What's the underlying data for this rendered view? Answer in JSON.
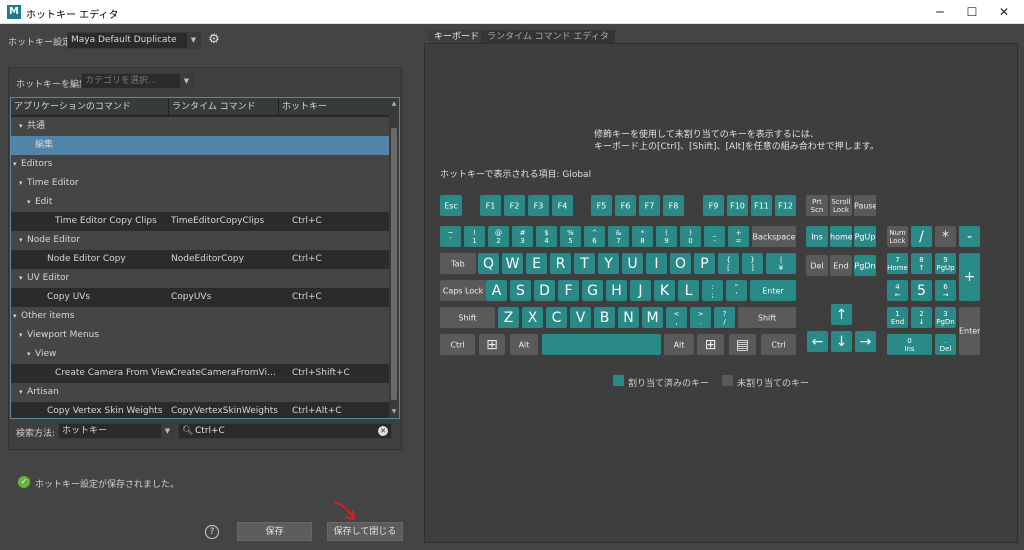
{
  "window": {
    "title": "ホットキー エディタ",
    "icon": "maya-icon",
    "min": "─",
    "max": "☐",
    "close": "✕"
  },
  "left": {
    "setting_label": "ホットキー設定:",
    "setting_value": "Maya Default Duplicate",
    "edit_label": "ホットキーを編集:",
    "edit_placeholder": "カテゴリを選択...",
    "columns": [
      "アプリケーションのコマンド",
      "ランタイム コマンド",
      "ホットキー"
    ],
    "rows": [
      {
        "kind": "grp",
        "indent": 1,
        "arrow": "▾",
        "name": "共通",
        "cmd": "",
        "key": ""
      },
      {
        "kind": "sel",
        "indent": 2,
        "arrow": "",
        "name": "編集",
        "cmd": "",
        "key": ""
      },
      {
        "kind": "grp",
        "indent": 0,
        "arrow": "▾",
        "name": "Editors",
        "cmd": "",
        "key": ""
      },
      {
        "kind": "grp",
        "indent": 1,
        "arrow": "▾",
        "name": "Time Editor",
        "cmd": "",
        "key": ""
      },
      {
        "kind": "grp",
        "indent": 2,
        "arrow": "▾",
        "name": "Edit",
        "cmd": "",
        "key": ""
      },
      {
        "kind": "leaf",
        "indent": 3,
        "arrow": "",
        "name": "Time Editor Copy Clips",
        "cmd": "TimeEditorCopyClips",
        "key": "Ctrl+C"
      },
      {
        "kind": "grp",
        "indent": 1,
        "arrow": "▾",
        "name": "Node Editor",
        "cmd": "",
        "key": ""
      },
      {
        "kind": "leaf",
        "indent": 2,
        "arrow": "",
        "name": "Node Editor Copy",
        "cmd": "NodeEditorCopy",
        "key": "Ctrl+C"
      },
      {
        "kind": "grp",
        "indent": 1,
        "arrow": "▾",
        "name": "UV Editor",
        "cmd": "",
        "key": ""
      },
      {
        "kind": "leaf",
        "indent": 2,
        "arrow": "",
        "name": "Copy UVs",
        "cmd": "CopyUVs",
        "key": "Ctrl+C"
      },
      {
        "kind": "grp",
        "indent": 0,
        "arrow": "▾",
        "name": "Other items",
        "cmd": "",
        "key": ""
      },
      {
        "kind": "grp",
        "indent": 1,
        "arrow": "▾",
        "name": "Viewport Menus",
        "cmd": "",
        "key": ""
      },
      {
        "kind": "grp",
        "indent": 2,
        "arrow": "▾",
        "name": "View",
        "cmd": "",
        "key": ""
      },
      {
        "kind": "leaf",
        "indent": 3,
        "arrow": "",
        "name": "Create Camera From View",
        "cmd": "CreateCameraFromVi…",
        "key": "Ctrl+Shift+C"
      },
      {
        "kind": "grp",
        "indent": 1,
        "arrow": "▾",
        "name": "Artisan",
        "cmd": "",
        "key": ""
      },
      {
        "kind": "leaf",
        "indent": 2,
        "arrow": "",
        "name": "Copy Vertex Skin Weights",
        "cmd": "CopyVertexSkinWeights",
        "key": "Ctrl+Alt+C"
      }
    ],
    "search_label": "検索方法:",
    "search_mode": "ホットキー",
    "search_value": "Ctrl+C",
    "status": "ホットキー設定が保存されました。",
    "help": "?",
    "save": "保存",
    "save_close": "保存して閉じる"
  },
  "right": {
    "tabs": [
      "キーボード",
      "ランタイム コマンド エディタ"
    ],
    "hint1": "修飾キーを使用して未割り当てのキーを表示するには、",
    "hint2": "キーボード上の[Ctrl]、[Shift]、[Alt]を任意の組み合わせで押します。",
    "shown_items": "ホットキーで表示される項目: Global",
    "legend_assigned": "割り当て済みのキー",
    "legend_unassigned": "未割り当てのキー",
    "color_assigned": "#2a8a87",
    "color_unassigned": "#5a5a5a"
  },
  "keyboard": [
    {
      "t": "Esc",
      "on": 1
    },
    {
      "t": "F1",
      "on": 1
    },
    {
      "t": "F2",
      "on": 1
    },
    {
      "t": "F3",
      "on": 1
    },
    {
      "t": "F4",
      "on": 1
    },
    {
      "t": "F5",
      "on": 1
    },
    {
      "t": "F6",
      "on": 1
    },
    {
      "t": "F7",
      "on": 1
    },
    {
      "t": "F8",
      "on": 1
    },
    {
      "t": "F9",
      "on": 1
    },
    {
      "t": "F10",
      "on": 1
    },
    {
      "t": "F11",
      "on": 1
    },
    {
      "t": "F12",
      "on": 1
    },
    {
      "t": "Prt\nScn",
      "on": 0
    },
    {
      "t": "Scroll\nLock",
      "on": 0
    },
    {
      "t": "Pause",
      "on": 0
    },
    {
      "t": "~\n`",
      "on": 1
    },
    {
      "t": "!\n1",
      "on": 1
    },
    {
      "t": "@\n2",
      "on": 1
    },
    {
      "t": "#\n3",
      "on": 1
    },
    {
      "t": "$\n4",
      "on": 1
    },
    {
      "t": "%\n5",
      "on": 1
    },
    {
      "t": "^\n6",
      "on": 1
    },
    {
      "t": "&\n7",
      "on": 1
    },
    {
      "t": "*\n8",
      "on": 1
    },
    {
      "t": "(\n9",
      "on": 1
    },
    {
      "t": ")\n0",
      "on": 1
    },
    {
      "t": "_\n-",
      "on": 1
    },
    {
      "t": "+\n=",
      "on": 1
    },
    {
      "t": "Backspace",
      "on": 0
    },
    {
      "t": "Ins",
      "on": 1
    },
    {
      "t": "home",
      "on": 1
    },
    {
      "t": "PgUp",
      "on": 1
    },
    {
      "t": "Num\nLock",
      "on": 0
    },
    {
      "t": "/",
      "on": 1,
      "big": 1
    },
    {
      "t": "*",
      "on": 0,
      "big": 1
    },
    {
      "t": "-",
      "on": 1,
      "big": 1
    },
    {
      "t": "Tab",
      "on": 0
    },
    {
      "t": "Q",
      "on": 1,
      "big": 1
    },
    {
      "t": "W",
      "on": 1,
      "big": 1
    },
    {
      "t": "E",
      "on": 1,
      "big": 1
    },
    {
      "t": "R",
      "on": 1,
      "big": 1
    },
    {
      "t": "T",
      "on": 1,
      "big": 1
    },
    {
      "t": "Y",
      "on": 1,
      "big": 1
    },
    {
      "t": "U",
      "on": 1,
      "big": 1
    },
    {
      "t": "I",
      "on": 1,
      "big": 1
    },
    {
      "t": "O",
      "on": 1,
      "big": 1
    },
    {
      "t": "P",
      "on": 1,
      "big": 1
    },
    {
      "t": "{\n[",
      "on": 1
    },
    {
      "t": "}\n]",
      "on": 1
    },
    {
      "t": "|\n¥",
      "on": 1
    },
    {
      "t": "Del",
      "on": 0
    },
    {
      "t": "End",
      "on": 0
    },
    {
      "t": "PgDn",
      "on": 1
    },
    {
      "t": "7\nHome",
      "on": 1
    },
    {
      "t": "8\n↑",
      "on": 1
    },
    {
      "t": "9\nPgUp",
      "on": 1
    },
    {
      "t": "+",
      "on": 1,
      "big": 1
    },
    {
      "t": "Caps Lock",
      "on": 0
    },
    {
      "t": "A",
      "on": 1,
      "big": 1
    },
    {
      "t": "S",
      "on": 1,
      "big": 1
    },
    {
      "t": "D",
      "on": 1,
      "big": 1
    },
    {
      "t": "F",
      "on": 1,
      "big": 1
    },
    {
      "t": "G",
      "on": 1,
      "big": 1
    },
    {
      "t": "H",
      "on": 1,
      "big": 1
    },
    {
      "t": "J",
      "on": 1,
      "big": 1
    },
    {
      "t": "K",
      "on": 1,
      "big": 1
    },
    {
      "t": "L",
      "on": 1,
      "big": 1
    },
    {
      "t": ":\n;",
      "on": 1
    },
    {
      "t": "\"\n'",
      "on": 1
    },
    {
      "t": "Enter",
      "on": 1
    },
    {
      "t": "4\n←",
      "on": 1
    },
    {
      "t": "5",
      "on": 1,
      "big": 1
    },
    {
      "t": "6\n→",
      "on": 1
    },
    {
      "t": "Shift",
      "on": 0
    },
    {
      "t": "Z",
      "on": 1,
      "big": 1
    },
    {
      "t": "X",
      "on": 1,
      "big": 1
    },
    {
      "t": "C",
      "on": 1,
      "big": 1
    },
    {
      "t": "V",
      "on": 1,
      "big": 1
    },
    {
      "t": "B",
      "on": 1,
      "big": 1
    },
    {
      "t": "N",
      "on": 1,
      "big": 1
    },
    {
      "t": "M",
      "on": 1,
      "big": 1
    },
    {
      "t": "<\n,",
      "on": 1
    },
    {
      "t": ">\n.",
      "on": 1
    },
    {
      "t": "?\n/",
      "on": 1
    },
    {
      "t": "Shift",
      "on": 0
    },
    {
      "t": "↑",
      "on": 1,
      "big": 1
    },
    {
      "t": "1\nEnd",
      "on": 1
    },
    {
      "t": "2\n↓",
      "on": 1
    },
    {
      "t": "3\nPgDn",
      "on": 1
    },
    {
      "t": "Enter",
      "on": 0
    },
    {
      "t": "Ctrl",
      "on": 0
    },
    {
      "t": "⊞",
      "on": 0,
      "big": 1
    },
    {
      "t": "Alt",
      "on": 0
    },
    {
      "t": "",
      "on": 1
    },
    {
      "t": "Alt",
      "on": 0
    },
    {
      "t": "⊞",
      "on": 0,
      "big": 1
    },
    {
      "t": "▤",
      "on": 0,
      "big": 1
    },
    {
      "t": "Ctrl",
      "on": 0
    },
    {
      "t": "←",
      "on": 1,
      "big": 1
    },
    {
      "t": "↓",
      "on": 1,
      "big": 1
    },
    {
      "t": "→",
      "on": 1,
      "big": 1
    },
    {
      "t": "0\nIns",
      "on": 1
    },
    {
      "t": ".\nDel",
      "on": 1
    }
  ]
}
